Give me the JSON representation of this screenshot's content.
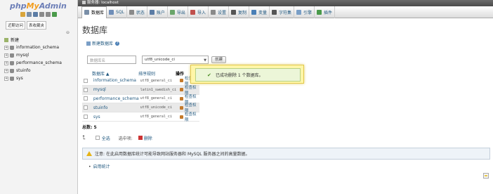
{
  "logo": {
    "php": "php",
    "my": "My",
    "admin": "Admin"
  },
  "nav": {
    "tabs": [
      "近期访问",
      "表收藏夹"
    ],
    "collapse_label": "⊖",
    "new_label": "新建",
    "databases": [
      "information_schema",
      "mysql",
      "performance_schema",
      "stuinfo",
      "sys"
    ]
  },
  "server": {
    "label": "服务器: localhost"
  },
  "menu": [
    {
      "label": "数据库",
      "icon": "database-icon",
      "color": "#7a8fa8"
    },
    {
      "label": "SQL",
      "icon": "sql-icon",
      "color": "#6f8eb8"
    },
    {
      "label": "状态",
      "icon": "status-icon",
      "color": "#8a8a8a"
    },
    {
      "label": "账户",
      "icon": "accounts-icon",
      "color": "#5b7ca5"
    },
    {
      "label": "导出",
      "icon": "export-icon",
      "color": "#6aa56a"
    },
    {
      "label": "导入",
      "icon": "import-icon",
      "color": "#c0504d"
    },
    {
      "label": "设置",
      "icon": "settings-icon",
      "color": "#8a8a8a"
    },
    {
      "label": "复制",
      "icon": "replication-icon",
      "color": "#555555"
    },
    {
      "label": "变量",
      "icon": "variables-icon",
      "color": "#4a7fb6"
    },
    {
      "label": "字符集",
      "icon": "charsets-icon",
      "color": "#555555"
    },
    {
      "label": "引擎",
      "icon": "engines-icon",
      "color": "#7a9fc7"
    },
    {
      "label": "插件",
      "icon": "plugins-icon",
      "color": "#4a9a4a"
    }
  ],
  "main": {
    "title": "数据库",
    "create_link": "新建数据库",
    "db_name_placeholder": "数据库名",
    "collation": "utf8_unicode_ci",
    "create_button": "创建"
  },
  "table": {
    "headers": {
      "name": "数据库 ▲",
      "collation": "排序规则",
      "action": "操作"
    },
    "rows": [
      {
        "name": "information_schema",
        "collation": "utf8_general_ci",
        "action": "检查权限"
      },
      {
        "name": "mysql",
        "collation": "latin1_swedish_ci",
        "action": "检查权限"
      },
      {
        "name": "performance_schema",
        "collation": "utf8_general_ci",
        "action": "检查权限"
      },
      {
        "name": "stuinfo",
        "collation": "utf8_unicode_ci",
        "action": "检查权限"
      },
      {
        "name": "sys",
        "collation": "utf8_general_ci",
        "action": "检查权限"
      }
    ],
    "total_label": "总数:",
    "total_value": "5"
  },
  "bulk": {
    "select_all": "全选",
    "selected_label": "选中项:",
    "delete": "删除"
  },
  "notice": {
    "label": "注意:",
    "text": "在此启用数据库统计可能导致网站服务器和 MySQL 服务器之间的高量数据。"
  },
  "stats_link": "启用统计",
  "toast": {
    "text": "已成功删除 1 个数据库。"
  },
  "colors": {
    "link": "#235a81",
    "toast_bg": "#fff6a8",
    "success_bg": "#ecf6d8"
  }
}
